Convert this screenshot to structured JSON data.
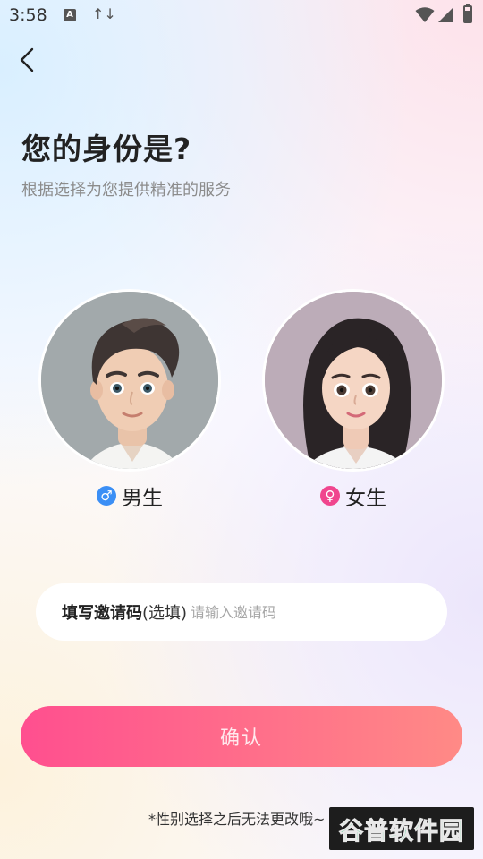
{
  "status_bar": {
    "time": "3:58",
    "notification_icon_letter": "A",
    "data_icon": "↑↓",
    "icons": [
      "wifi-icon",
      "signal-icon",
      "battery-icon"
    ]
  },
  "header": {
    "back_icon": "chevron-left-icon",
    "title": "您的身份是?",
    "subtitle": "根据选择为您提供精准的服务"
  },
  "gender_options": [
    {
      "id": "male",
      "label": "男生",
      "symbol": "♂",
      "color": "#3b8ff5"
    },
    {
      "id": "female",
      "label": "女生",
      "symbol": "♀",
      "color": "#f0458e"
    }
  ],
  "invite": {
    "label": "填写邀请码",
    "optional": "(选填)",
    "placeholder": "请输入邀请码",
    "value": ""
  },
  "confirm_button": {
    "label": "确认",
    "gradient": [
      "#ff4f8f",
      "#ff8a86"
    ]
  },
  "footer_note": "*性别选择之后无法更改哦~",
  "watermark": "谷普软件园"
}
